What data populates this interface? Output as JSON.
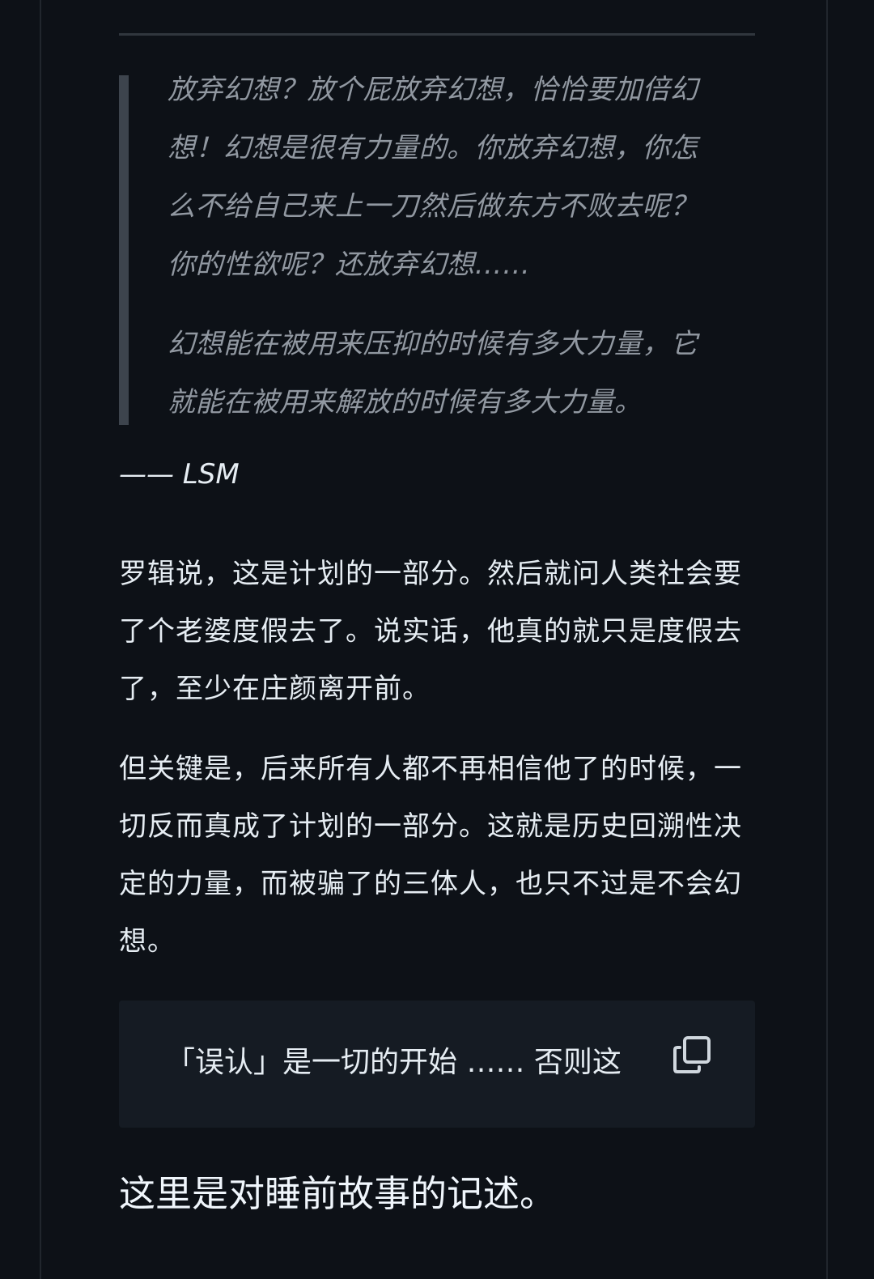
{
  "blockquote": {
    "paragraphs": [
      "放弃幻想？放个屁放弃幻想，恰恰要加倍幻想！幻想是很有力量的。你放弃幻想，你怎么不给自己来上一刀然后做东方不败去呢？你的性欲呢？还放弃幻想……",
      "幻想能在被用来压抑的时候有多大力量，它就能在被用来解放的时候有多大力量。"
    ]
  },
  "attribution": "—— LSM",
  "paragraphs": [
    "罗辑说，这是计划的一部分。然后就问人类社会要了个老婆度假去了。说实话，他真的就只是度假去了，至少在庄颜离开前。",
    "但关键是，后来所有人都不再相信他了的时候，一切反而真成了计划的一部分。这就是历史回溯性决定的力量，而被骗了的三体人，也只不过是不会幻想。"
  ],
  "code_block": {
    "text": "「误认」是一切的开始 …… 否则这",
    "copy_icon": "copy-icon"
  },
  "heading": "这里是对睡前故事的记述。",
  "colors": {
    "background": "#0d1117",
    "text": "#e6edf3",
    "quote_text": "#9198a1",
    "quote_bar": "#3d444d",
    "code_bg": "#151b23"
  }
}
